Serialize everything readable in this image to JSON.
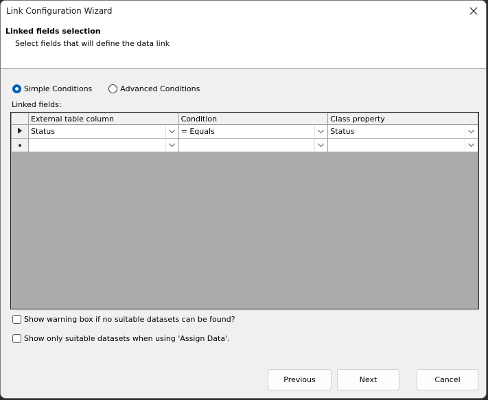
{
  "window": {
    "title": "Link Configuration Wizard",
    "close_icon": "close-icon"
  },
  "header": {
    "heading": "Linked fields selection",
    "subheading": "Select fields that will define the data link"
  },
  "mode": {
    "options": [
      {
        "label": "Simple Conditions",
        "checked": true
      },
      {
        "label": "Advanced Conditions",
        "checked": false
      }
    ]
  },
  "grid": {
    "label": "Linked fields:",
    "columns": [
      "External table column",
      "Condition",
      "Class property"
    ],
    "rows": [
      {
        "indicator": "current-row-arrow",
        "values": [
          "Status",
          "= Equals",
          "Status"
        ]
      },
      {
        "indicator": "new-row-asterisk",
        "values": [
          "",
          "",
          ""
        ]
      }
    ]
  },
  "options": {
    "show_warning": {
      "label": "Show warning box if no suitable datasets can be found?",
      "checked": false
    },
    "show_only_suitable": {
      "label": "Show only suitable datasets when using 'Assign Data'.",
      "checked": false
    }
  },
  "buttons": {
    "previous": "Previous",
    "next": "Next",
    "cancel": "Cancel"
  }
}
